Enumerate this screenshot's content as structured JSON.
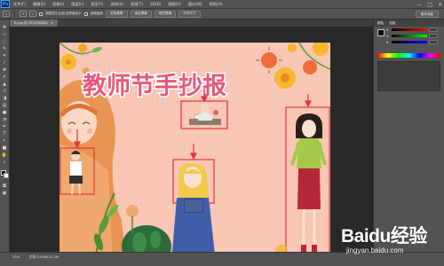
{
  "menubar": {
    "logo": "Ps",
    "items": [
      "文件(F)",
      "编辑(E)",
      "图像(I)",
      "图层(L)",
      "类型(Y)",
      "选择(S)",
      "滤镜(T)",
      "3D(D)",
      "视图(V)",
      "窗口(W)",
      "帮助(H)"
    ],
    "window_controls": [
      "—",
      "□",
      "✕"
    ]
  },
  "options": {
    "label_all_layers": "调整显示全部/全屏幕显示",
    "label_scrubby": "细微缩放",
    "btn_actual": "实际像素",
    "btn_fit": "适合屏幕",
    "btn_fill": "填充屏幕",
    "btn_print": "打印尺寸",
    "workspace": "基本功能"
  },
  "document": {
    "tab_title": "fc.jpg @ 25%(RGB/8)",
    "tab_close": "×"
  },
  "canvas": {
    "title": "教师节手抄报",
    "bg_color": "#f7c5b3",
    "title_color": "#e8577d",
    "highlight_color": "#e5333a"
  },
  "panels": {
    "color_tab": "颜色",
    "swatches_tab": "色板",
    "r_label": "R",
    "g_label": "G",
    "b_label": "B"
  },
  "status": {
    "zoom": "25%",
    "doc_info": "文档:2.05M/24.2M"
  },
  "watermark": {
    "logo_text": "Baidu经验",
    "url": "jingyan.baidu.com"
  }
}
